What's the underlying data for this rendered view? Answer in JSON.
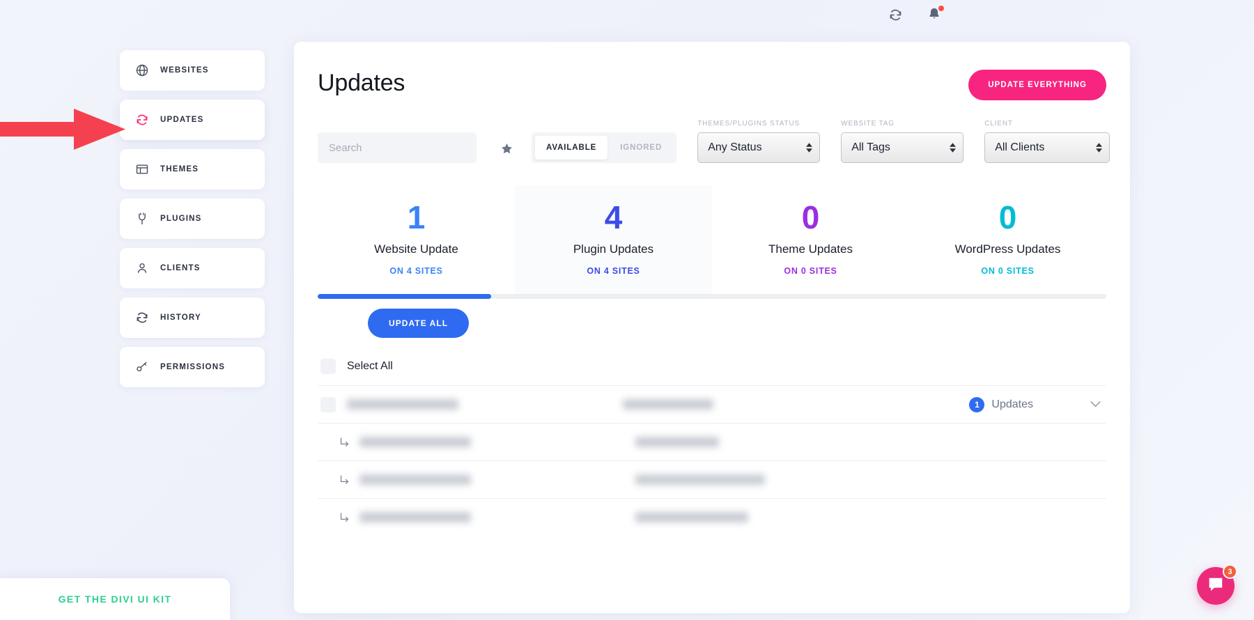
{
  "topbar": {
    "refresh_icon": "refresh-icon",
    "notifications_icon": "bell-icon",
    "has_notification": true
  },
  "sidebar": {
    "items": [
      {
        "label": "Websites",
        "icon": "globe-icon",
        "active": false
      },
      {
        "label": "Updates",
        "icon": "refresh-icon",
        "active": true
      },
      {
        "label": "Themes",
        "icon": "window-icon",
        "active": false
      },
      {
        "label": "Plugins",
        "icon": "plug-icon",
        "active": false
      },
      {
        "label": "Clients",
        "icon": "user-icon",
        "active": false
      },
      {
        "label": "History",
        "icon": "refresh-icon",
        "active": false
      },
      {
        "label": "Permissions",
        "icon": "key-icon",
        "active": false
      }
    ]
  },
  "header": {
    "title": "Updates",
    "update_everything_label": "Update Everything"
  },
  "filters": {
    "search_placeholder": "Search",
    "search_value": "",
    "favorite_icon": "star-icon",
    "toggle": {
      "available_label": "Available",
      "ignored_label": "Ignored",
      "selected": "Available"
    },
    "status": {
      "label": "Themes/Plugins Status",
      "value": "Any Status"
    },
    "tag": {
      "label": "Website Tag",
      "value": "All Tags"
    },
    "client": {
      "label": "Client",
      "value": "All Clients"
    }
  },
  "stats": {
    "cards": [
      {
        "count": "1",
        "name": "Website Update",
        "sites": "On 4 Sites",
        "color": "#3b82f6",
        "selected": false
      },
      {
        "count": "4",
        "name": "Plugin Updates",
        "sites": "On 4 Sites",
        "color": "#3b4ce8",
        "selected": true
      },
      {
        "count": "0",
        "name": "Theme Updates",
        "sites": "On 0 Sites",
        "color": "#9b2fe0",
        "selected": false
      },
      {
        "count": "0",
        "name": "WordPress Updates",
        "sites": "On 0 Sites",
        "color": "#00bcd4",
        "selected": false
      }
    ]
  },
  "progress": {
    "percent": 22,
    "fill_color": "#2f6bf0"
  },
  "actions": {
    "update_all_label": "Update All"
  },
  "list": {
    "select_all_label": "Select All",
    "rows": [
      {
        "type": "parent",
        "name": "",
        "url": "",
        "updates_count": "1",
        "updates_label": "Updates"
      },
      {
        "type": "child",
        "name": "",
        "url": ""
      },
      {
        "type": "child",
        "name": "",
        "url": ""
      },
      {
        "type": "child",
        "name": "",
        "url": ""
      }
    ]
  },
  "footer": {
    "divi_kit_label": "Get the Divi UI Kit"
  },
  "chat": {
    "icon": "chat-bubble-icon",
    "unread_count": "3",
    "color": "#ec2a7c"
  },
  "annotation": {
    "arrow_color": "#f5414f",
    "points_to": "Updates"
  }
}
